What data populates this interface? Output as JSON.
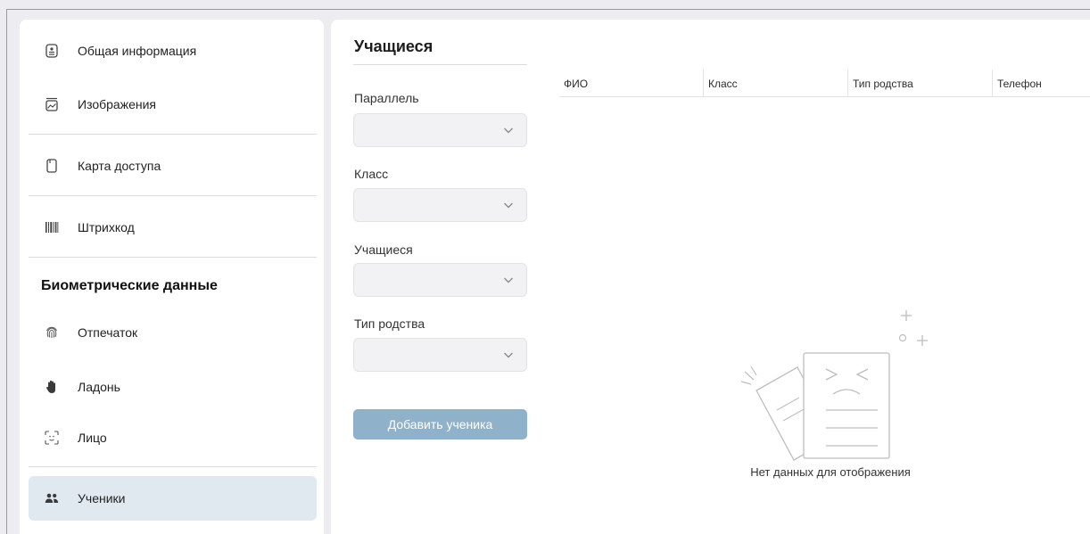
{
  "sidebar": {
    "items": [
      {
        "label": "Общая информация",
        "icon": "id-card-icon"
      },
      {
        "label": "Изображения",
        "icon": "image-icon"
      },
      {
        "label": "Карта доступа",
        "icon": "access-card-icon"
      },
      {
        "label": "Штрихкод",
        "icon": "barcode-icon"
      },
      {
        "label": "Отпечаток",
        "icon": "fingerprint-icon"
      },
      {
        "label": "Ладонь",
        "icon": "palm-icon"
      },
      {
        "label": "Лицо",
        "icon": "face-scan-icon"
      },
      {
        "label": "Ученики",
        "icon": "students-icon",
        "active": true
      }
    ],
    "section_biometric": "Биометрические данные"
  },
  "panel": {
    "title": "Учащиеся",
    "fields": [
      {
        "label": "Параллель",
        "value": ""
      },
      {
        "label": "Класс",
        "value": ""
      },
      {
        "label": "Учащиеся",
        "value": ""
      },
      {
        "label": "Тип родства",
        "value": ""
      }
    ],
    "add_button": "Добавить ученика"
  },
  "table": {
    "columns": [
      "ФИО",
      "Класс",
      "Тип родства",
      "Телефон"
    ],
    "empty_text": "Нет данных для отображения"
  },
  "colors": {
    "accent": "#8fb1c9",
    "active_bg": "#dfe9ef",
    "page_bg": "#ededf1"
  }
}
